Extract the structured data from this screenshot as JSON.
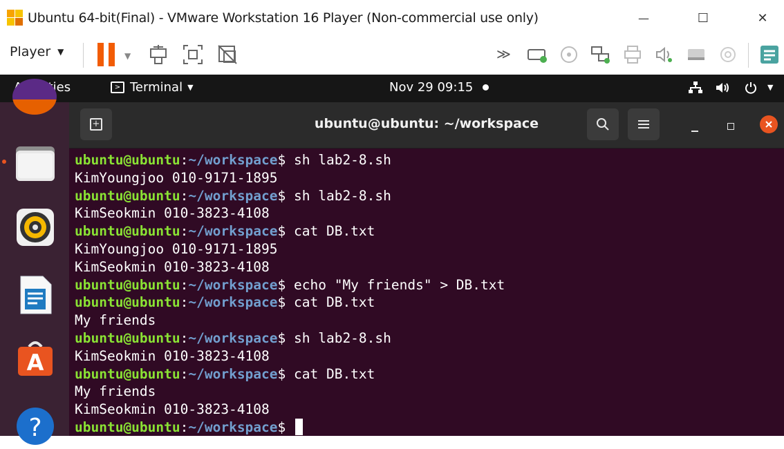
{
  "window": {
    "title": "Ubuntu 64-bit(Final) - VMware Workstation 16 Player (Non-commercial use only)",
    "minimize_glyph": "—",
    "maximize_glyph": "☐",
    "close_glyph": "✕"
  },
  "toolbar": {
    "player_label": "Player",
    "fast_forward_glyph": "≫"
  },
  "topbar": {
    "activities": "Activities",
    "app_menu": "Terminal",
    "clock": "Nov 29  09:15"
  },
  "dock": {
    "items": [
      "files-icon",
      "rhythmbox-icon",
      "libreoffice-writer-icon",
      "ubuntu-software-icon",
      "help-icon"
    ]
  },
  "terminal": {
    "title": "ubuntu@ubuntu: ~/workspace",
    "prompt_user": "ubuntu@ubuntu",
    "prompt_path": "~/workspace",
    "lines": [
      {
        "prompt": true,
        "text": " sh lab2-8.sh"
      },
      {
        "prompt": false,
        "text": "KimYoungjoo 010-9171-1895"
      },
      {
        "prompt": true,
        "text": " sh lab2-8.sh"
      },
      {
        "prompt": false,
        "text": "KimSeokmin 010-3823-4108"
      },
      {
        "prompt": true,
        "text": " cat DB.txt"
      },
      {
        "prompt": false,
        "text": "KimYoungjoo 010-9171-1895"
      },
      {
        "prompt": false,
        "text": "KimSeokmin 010-3823-4108"
      },
      {
        "prompt": true,
        "text": " echo \"My friends\" > DB.txt"
      },
      {
        "prompt": true,
        "text": " cat DB.txt"
      },
      {
        "prompt": false,
        "text": "My friends"
      },
      {
        "prompt": true,
        "text": " sh lab2-8.sh"
      },
      {
        "prompt": false,
        "text": "KimSeokmin 010-3823-4108"
      },
      {
        "prompt": true,
        "text": " cat DB.txt"
      },
      {
        "prompt": false,
        "text": "My friends"
      },
      {
        "prompt": false,
        "text": "KimSeokmin 010-3823-4108"
      },
      {
        "prompt": true,
        "text": " ",
        "cursor": true
      }
    ]
  },
  "colors": {
    "terminal_bg": "#300a24",
    "prompt_user": "#8ae234",
    "prompt_path": "#729fcf",
    "pause_orange": "#f25c05",
    "close_orange": "#e95420"
  }
}
